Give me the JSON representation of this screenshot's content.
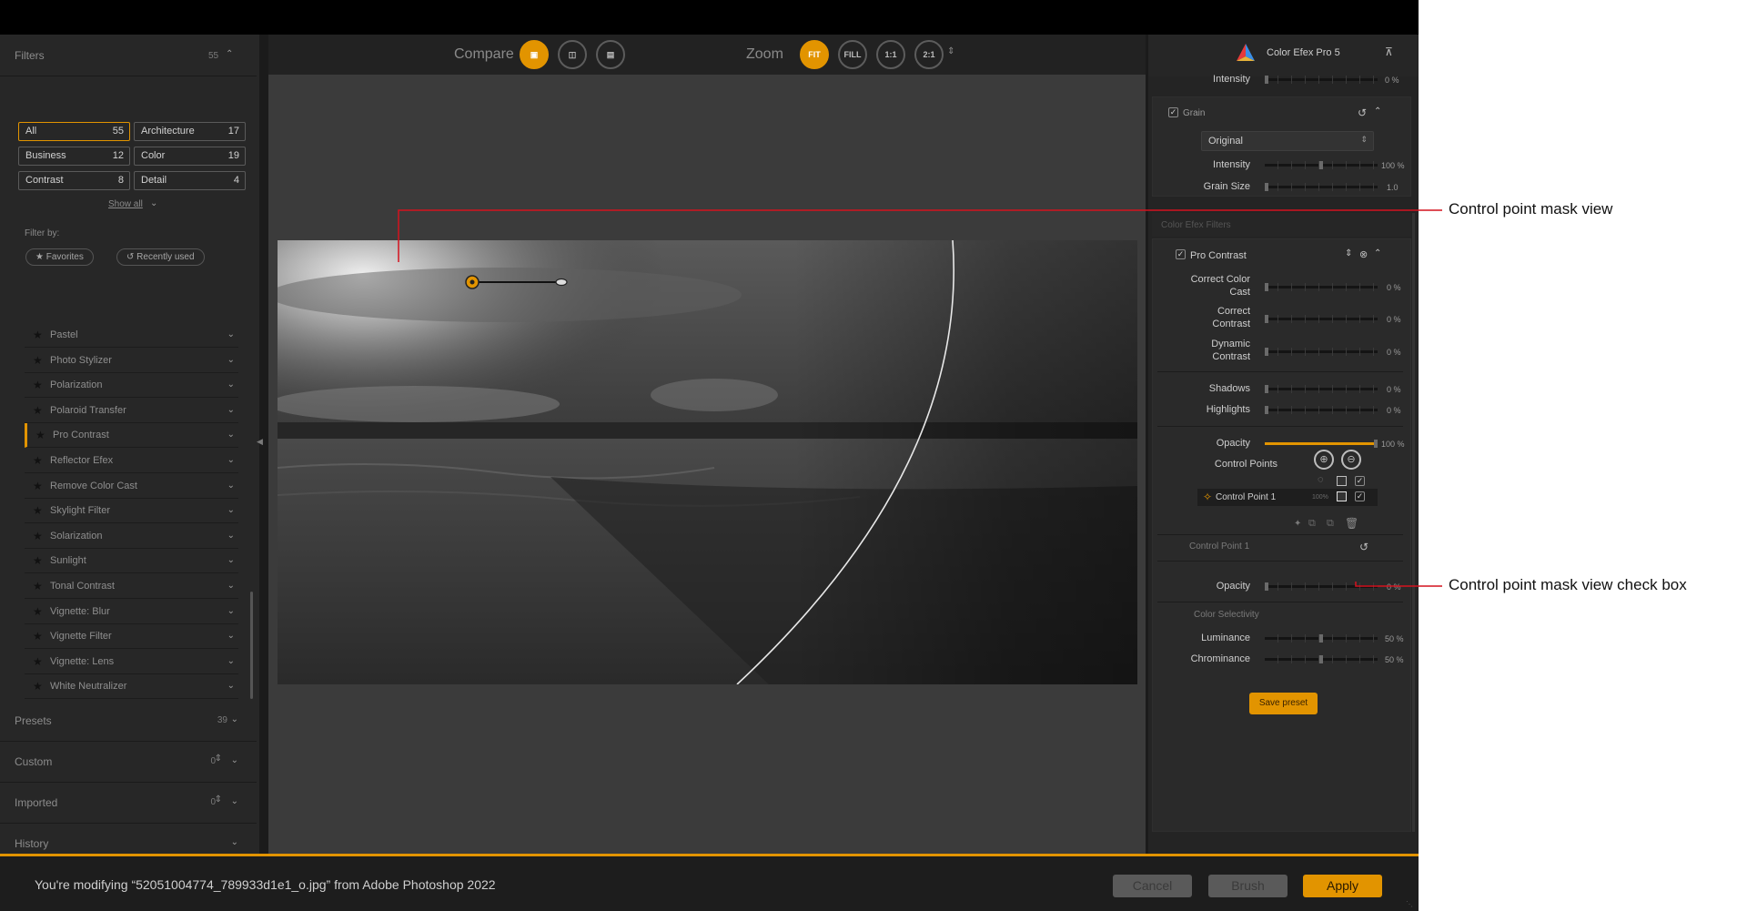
{
  "left": {
    "filters_title": "Filters",
    "filters_count": "55",
    "categories": [
      {
        "label": "All",
        "count": "55"
      },
      {
        "label": "Architecture",
        "count": "17"
      },
      {
        "label": "Business",
        "count": "12"
      },
      {
        "label": "Color",
        "count": "19"
      },
      {
        "label": "Contrast",
        "count": "8"
      },
      {
        "label": "Detail",
        "count": "4"
      }
    ],
    "show_all": "Show all",
    "filter_by": "Filter by:",
    "pill_favorites": "Favorites",
    "pill_recent": "Recently used",
    "filter_items": [
      "Pastel",
      "Photo Stylizer",
      "Polarization",
      "Polaroid Transfer",
      "Pro Contrast",
      "Reflector Efex",
      "Remove Color Cast",
      "Skylight Filter",
      "Solarization",
      "Sunlight",
      "Tonal Contrast",
      "Vignette: Blur",
      "Vignette Filter",
      "Vignette: Lens",
      "White Neutralizer"
    ],
    "selected_filter": "Pro Contrast",
    "sections": [
      {
        "title": "Presets",
        "count": "39"
      },
      {
        "title": "Custom",
        "count": "0"
      },
      {
        "title": "Imported",
        "count": "0"
      },
      {
        "title": "History",
        "count": ""
      }
    ]
  },
  "toolbar": {
    "compare_label": "Compare",
    "zoom_label": "Zoom",
    "zoom_fit": "FIT",
    "zoom_fill": "FILL",
    "zoom_1_1": "1:1",
    "zoom_2_1": "2:1"
  },
  "right": {
    "title": "Color Efex Pro 5",
    "top_intensity_label": "Intensity",
    "top_intensity_val": "0 %",
    "grain_title": "Grain",
    "grain_mode": "Original",
    "grain_intensity_label": "Intensity",
    "grain_intensity_val": "100 %",
    "grain_intensity": 0.5,
    "grain_size_label": "Grain Size",
    "grain_size_val": "1.0",
    "filters_section": "Color Efex Filters",
    "pro_contrast_title": "Pro Contrast",
    "ccc_label_1": "Correct Color",
    "ccc_label_2": "Cast",
    "ccc_val": "0 %",
    "cc_label_1": "Correct",
    "cc_label_2": "Contrast",
    "cc_val": "0 %",
    "dc_label_1": "Dynamic",
    "dc_label_2": "Contrast",
    "dc_val": "0 %",
    "shadows_label": "Shadows",
    "shadows_val": "0 %",
    "highlights_label": "Highlights",
    "highlights_val": "0 %",
    "opacity_label": "Opacity",
    "opacity_val": "100 %",
    "opacity": 1.0,
    "control_points_label": "Control Points",
    "cp_name": "Control Point 1",
    "cp_pct": "100%",
    "cp_section_title": "Control Point 1",
    "cp_opacity_label": "Opacity",
    "cp_opacity_val": "0 %",
    "color_selectivity": "Color Selectivity",
    "luminance_label": "Luminance",
    "luminance_val": "50 %",
    "luminance": 0.5,
    "chrominance_label": "Chrominance",
    "chrominance_val": "50 %",
    "chrominance": 0.5,
    "save_preset": "Save preset"
  },
  "bottom": {
    "message": "You're modifying “52051004774_789933d1e1_o.jpg” from Adobe Photoshop 2022",
    "cancel": "Cancel",
    "brush": "Brush",
    "apply": "Apply"
  },
  "annotations": {
    "mask_view": "Control point mask view",
    "mask_checkbox": "Control point mask view check box"
  },
  "colors": {
    "accent": "#e29400",
    "callout_line": "#d4121e"
  }
}
